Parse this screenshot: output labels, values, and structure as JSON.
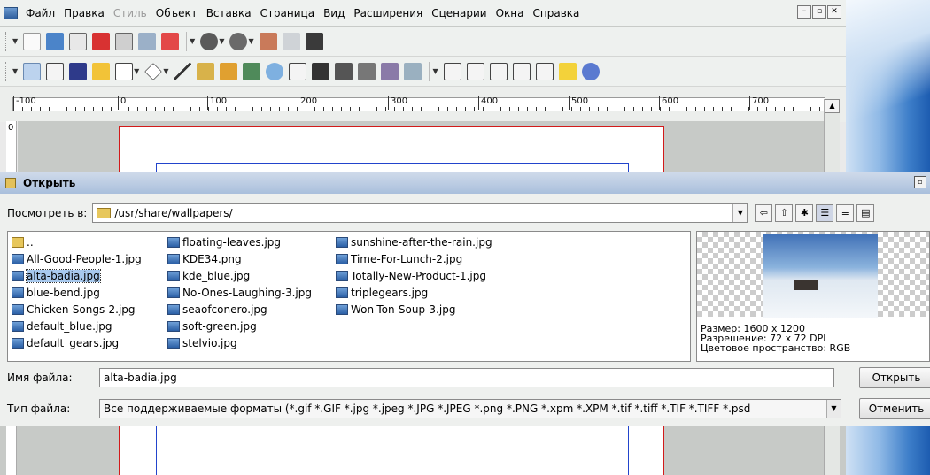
{
  "menubar": {
    "items": [
      {
        "label": "Файл",
        "disabled": false
      },
      {
        "label": "Правка",
        "disabled": false
      },
      {
        "label": "Стиль",
        "disabled": true
      },
      {
        "label": "Объект",
        "disabled": false
      },
      {
        "label": "Вставка",
        "disabled": false
      },
      {
        "label": "Страница",
        "disabled": false
      },
      {
        "label": "Вид",
        "disabled": false
      },
      {
        "label": "Расширения",
        "disabled": false
      },
      {
        "label": "Сценарии",
        "disabled": false
      },
      {
        "label": "Окна",
        "disabled": false
      },
      {
        "label": "Справка",
        "disabled": false
      }
    ]
  },
  "ruler": {
    "labels": [
      "-100",
      "0",
      "100",
      "200",
      "300",
      "400",
      "500",
      "600",
      "700"
    ],
    "vertical_label": "0"
  },
  "dialog": {
    "title": "Открыть",
    "look_in_label": "Посмотреть в:",
    "path": "/usr/share/wallpapers/",
    "files": [
      [
        {
          "name": "..",
          "type": "folder"
        },
        {
          "name": "All-Good-People-1.jpg",
          "type": "image"
        },
        {
          "name": "alta-badia.jpg",
          "type": "image",
          "selected": true
        },
        {
          "name": "blue-bend.jpg",
          "type": "image"
        },
        {
          "name": "Chicken-Songs-2.jpg",
          "type": "image"
        },
        {
          "name": "default_blue.jpg",
          "type": "image"
        },
        {
          "name": "default_gears.jpg",
          "type": "image"
        }
      ],
      [
        {
          "name": "floating-leaves.jpg",
          "type": "image"
        },
        {
          "name": "KDE34.png",
          "type": "image"
        },
        {
          "name": "kde_blue.jpg",
          "type": "image"
        },
        {
          "name": "No-Ones-Laughing-3.jpg",
          "type": "image"
        },
        {
          "name": "seaofconero.jpg",
          "type": "image"
        },
        {
          "name": "soft-green.jpg",
          "type": "image"
        },
        {
          "name": "stelvio.jpg",
          "type": "image"
        }
      ],
      [
        {
          "name": "sunshine-after-the-rain.jpg",
          "type": "image"
        },
        {
          "name": "Time-For-Lunch-2.jpg",
          "type": "image"
        },
        {
          "name": "Totally-New-Product-1.jpg",
          "type": "image"
        },
        {
          "name": "triplegears.jpg",
          "type": "image"
        },
        {
          "name": "Won-Ton-Soup-3.jpg",
          "type": "image"
        }
      ]
    ],
    "preview": {
      "size": "Размер: 1600 x 1200",
      "resolution": "Разрешение: 72 x 72 DPI",
      "colorspace": "Цветовое пространство: RGB"
    },
    "filename_label": "Имя файла:",
    "filename_value": "alta-badia.jpg",
    "filetype_label": "Тип файла:",
    "filetype_value": "Все поддерживаемые форматы (*.gif *.GIF *.jpg *.jpeg *.JPG *.JPEG *.png *.PNG *.xpm *.XPM *.tif *.tiff *.TIF *.TIFF *.psd",
    "open_button": "Открыть",
    "cancel_button": "Отменить"
  }
}
